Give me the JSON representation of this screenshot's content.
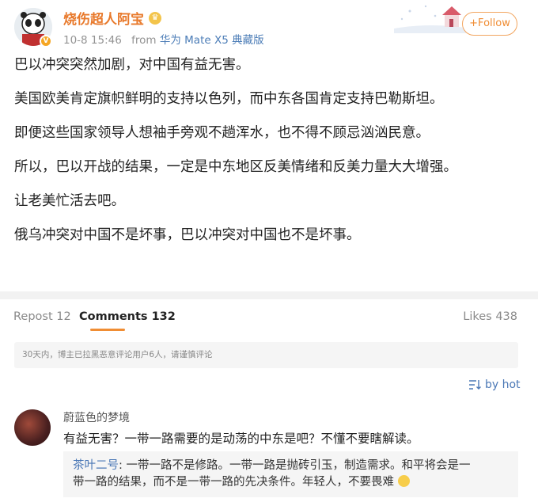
{
  "post": {
    "author": "烧伤超人阿宝",
    "timestamp": "10-8 15:46",
    "from_label": "from",
    "source": "华为 Mate X5 典藏版",
    "follow_label": "+Follow",
    "paragraphs": [
      "巴以冲突突然加剧，对中国有益无害。",
      "美国欧美肯定旗帜鲜明的支持以色列，而中东各国肯定支持巴勒斯坦。",
      "即便这些国家领导人想袖手旁观不趟浑水，也不得不顾忌汹汹民意。",
      "所以，巴以开战的结果，一定是中东地区反美情绪和反美力量大大增强。",
      "让老美忙活去吧。",
      "俄乌冲突对中国不是坏事，巴以冲突对中国也不是坏事。"
    ],
    "icons": {
      "verified": "verified-badge-icon",
      "crown": "crown-icon"
    }
  },
  "tabs": {
    "repost": "Repost 12",
    "comments": "Comments 132",
    "likes": "Likes 438"
  },
  "comments": {
    "notice": "30天内，博主已拉黑恶意评论用户6人，请谨慎评论",
    "sort_label": "by hot",
    "items": [
      {
        "user": "蔚蓝色的梦境",
        "text": "有益无害？一带一路需要的是动荡的中东是吧？不懂不要瞎解读。",
        "reply_user": "茶叶二号",
        "reply_colon": ":",
        "reply_line1": "一带一路不是修路。一带一路是抛砖引玉，制造需求。和平将会是一",
        "reply_line2": "带一路的结果，而不是一带一路的先决条件。年轻人，不要畏难"
      }
    ]
  },
  "colors": {
    "author": "#e8792b",
    "link": "#4b78b6",
    "accent": "#f08d34"
  }
}
